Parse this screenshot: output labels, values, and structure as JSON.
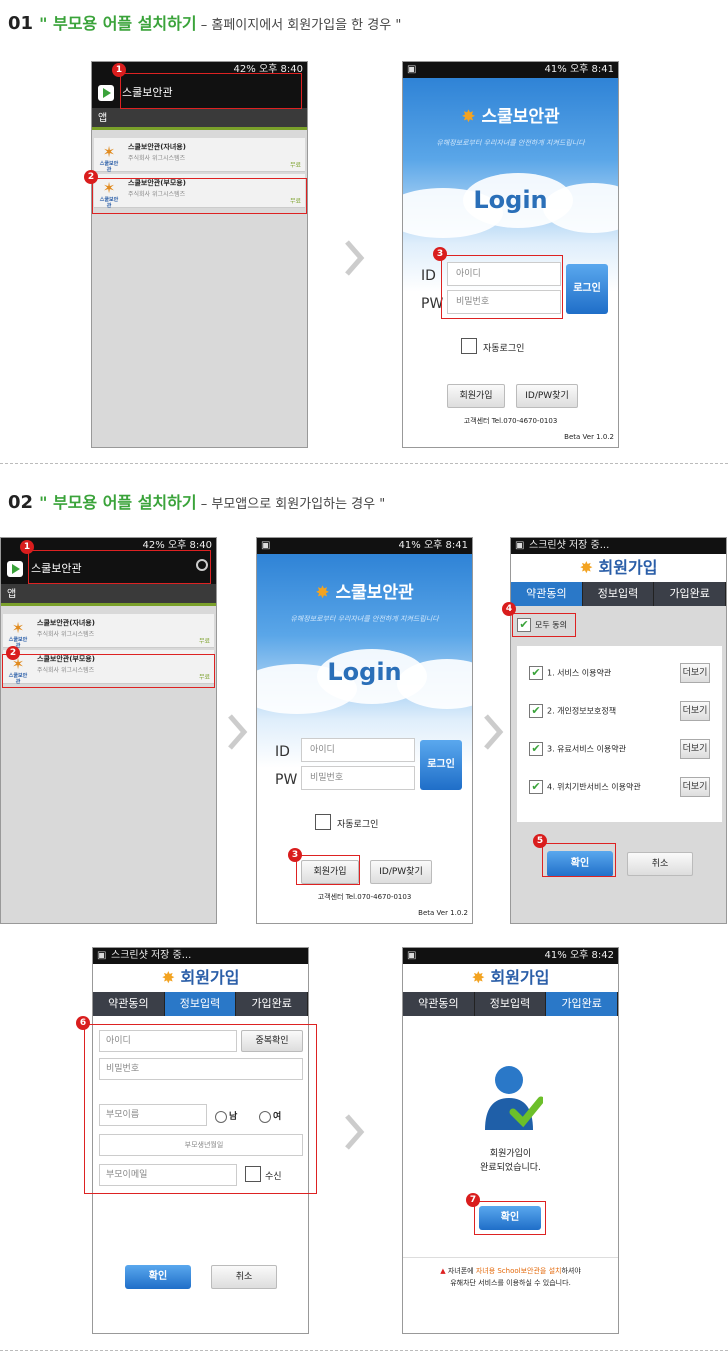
{
  "section1": {
    "num": "01",
    "title_green": "\" 부모용 어플 설치하기",
    "title_sub": " – 홈페이지에서 회원가입을 한 경우 \""
  },
  "section2": {
    "num": "02",
    "title_green": "\" 부모용 어플 설치하기",
    "title_sub": " – 부모앱으로 회원가입하는 경우 \""
  },
  "store": {
    "time": "오후 8:40",
    "battery": "42%",
    "search_text": "스쿨보안관",
    "tab": "앱",
    "items": [
      {
        "name": "스쿨보안관(자녀용)",
        "vendor": "주식회사 위그시스템즈",
        "price": "무료",
        "icon_label": "스쿨보안관"
      },
      {
        "name": "스쿨보안관(부모용)",
        "vendor": "주식회사 위그시스템즈",
        "price": "무료",
        "icon_label": "스쿨보안관"
      }
    ]
  },
  "login": {
    "time": "오후 8:41",
    "battery": "41%",
    "brand": "스쿨보안관",
    "slogan": "유해정보로부터 우리자녀를 안전하게 지켜드립니다",
    "title": "Login",
    "id_label": "ID",
    "pw_label": "PW",
    "id_placeholder": "아이디",
    "pw_placeholder": "비밀번호",
    "login_button": "로그인",
    "auto_login": "자동로그인",
    "join_button": "회원가입",
    "find_button": "ID/PW찾기",
    "contact": "고객센터 Tel.070-4670-0103",
    "version": "Beta Ver 1.0.2"
  },
  "join": {
    "status_saving": "스크린샷 저장 중...",
    "title": "회원가입",
    "steps": [
      "약관동의",
      "정보입력",
      "가입완료"
    ],
    "agree_all": "모두 동의",
    "terms": [
      "1. 서비스 이용약관",
      "2. 개인정보보호정책",
      "3. 유료서비스 이용약관",
      "4. 위치기반서비스 이용약관"
    ],
    "more": "더보기",
    "confirm": "확인",
    "cancel": "취소"
  },
  "form": {
    "id": "아이디",
    "dup_check": "중복확인",
    "password": "비밀번호",
    "parent_name": "부모이름",
    "male": "남",
    "female": "여",
    "birth": "부모생년월일",
    "email": "부모이메일",
    "receive": "수신",
    "confirm": "확인",
    "cancel": "취소"
  },
  "done": {
    "time": "오후 8:42",
    "battery": "41%",
    "message_1": "회원가입이",
    "message_2": "완료되었습니다.",
    "confirm": "확인",
    "note_pre": "자녀폰에 ",
    "note_hl": "자녀용 School보안관을 설치",
    "note_post": "하셔야",
    "note_2": "유해차단 서비스를 이용하실 수 있습니다."
  },
  "badges": [
    "1",
    "2",
    "3",
    "4",
    "5",
    "6",
    "7"
  ]
}
